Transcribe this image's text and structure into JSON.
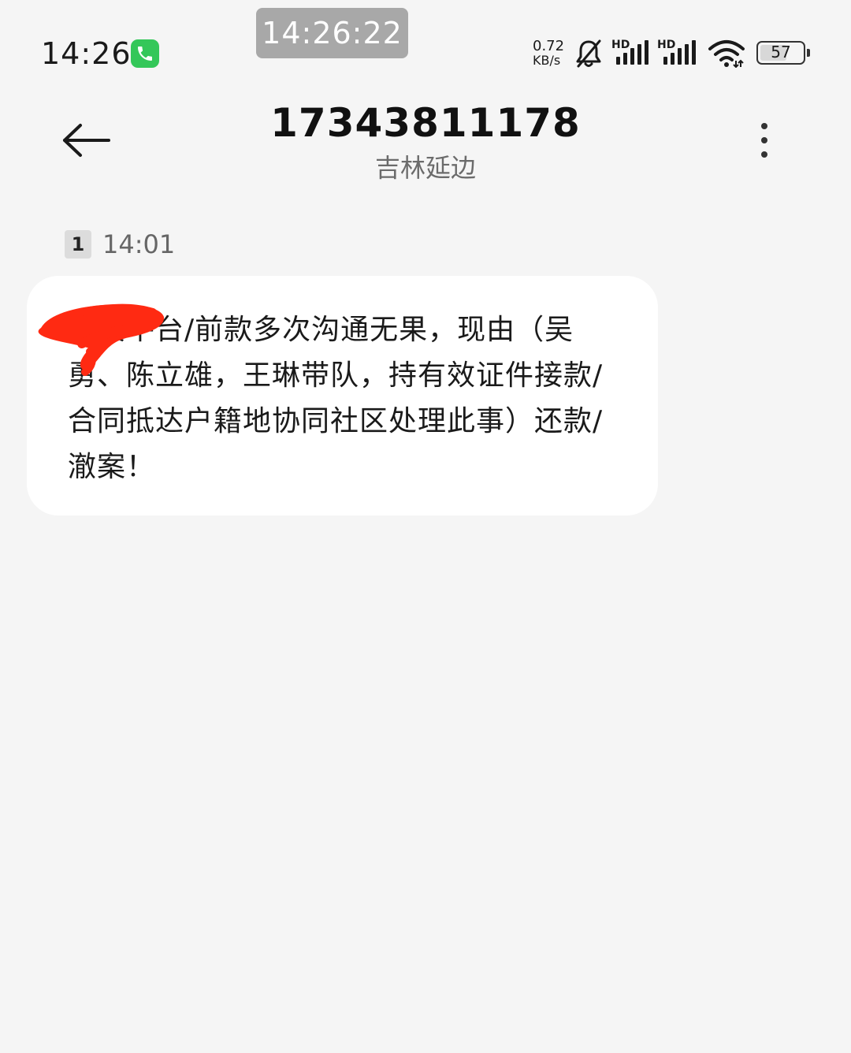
{
  "status_bar": {
    "time": "14:26",
    "clock_overlay": "14:26:22",
    "network_speed_value": "0.72",
    "network_speed_unit": "KB/s",
    "signal_1_label": "HD",
    "signal_2_label": "HD",
    "battery_level": "57",
    "icons": [
      "phone-call-icon",
      "bell-muted-icon",
      "signal-icon",
      "signal-icon",
      "wifi-icon",
      "battery-icon"
    ]
  },
  "header": {
    "title": "17343811178",
    "subtitle": "吉林延边",
    "back_icon": "back-arrow-icon",
    "more_icon": "more-vertical-icon"
  },
  "message": {
    "sim_slot": "1",
    "time": "14:01",
    "body": "消费平台/前款多次沟通无果，现由（吴勇、陈立雄，王琳带队，持有效证件接款/合同抵达户籍地协同社区处理此事）还款/澈案！",
    "redacted": true
  },
  "colors": {
    "background": "#f5f5f5",
    "bubble": "#ffffff",
    "call_green": "#34c759",
    "redaction": "#ff2a12",
    "clock_pill": "#a8a8a8"
  }
}
